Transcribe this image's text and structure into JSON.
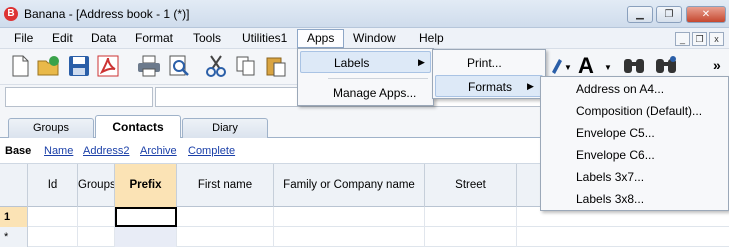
{
  "window": {
    "title": "Banana - [Address book - 1 (*)]",
    "logo_letter": "B",
    "minimize_label": "▁",
    "restore_label": "❐",
    "close_label": "✕",
    "mdi_minimize": "_",
    "mdi_restore": "❐",
    "mdi_close": "x"
  },
  "menubar": {
    "items": [
      "File",
      "Edit",
      "Data",
      "Format",
      "Tools",
      "Utilities1",
      "Apps",
      "Window",
      "Help"
    ],
    "active": "Apps"
  },
  "toolbar": {
    "font_letter": "A",
    "more_label": "»",
    "icons": [
      "new-file-icon",
      "open-folder-icon",
      "save-icon",
      "pdf-icon",
      "print-icon",
      "print-preview-icon",
      "cut-icon",
      "copy-icon",
      "paste-icon",
      "pen-icon",
      "font-color-icon",
      "find-icon",
      "find-replace-icon"
    ]
  },
  "tabs": [
    "Groups",
    "Contacts",
    "Diary"
  ],
  "active_tab": "Contacts",
  "views": {
    "current": "Base",
    "links": [
      "Name",
      "Address2",
      "Archive",
      "Complete"
    ]
  },
  "table": {
    "columns": [
      "Id",
      "Groups",
      "Prefix",
      "First name",
      "Family or Company name",
      "Street"
    ],
    "selected_column": "Prefix",
    "rows": [
      "1",
      "*"
    ]
  },
  "apps_menu": {
    "items": [
      "Labels",
      "Manage Apps..."
    ]
  },
  "labels_menu": {
    "items": [
      "Print...",
      "Formats"
    ]
  },
  "formats_menu": {
    "items": [
      "Address on A4...",
      "Composition (Default)...",
      "Envelope C5...",
      "Envelope C6...",
      "Labels 3x7...",
      "Labels 3x8..."
    ]
  },
  "colors": {
    "selected_header": "#fbe3b5",
    "link": "#1a3fa8",
    "menu_highlight": "#dde9f7"
  }
}
